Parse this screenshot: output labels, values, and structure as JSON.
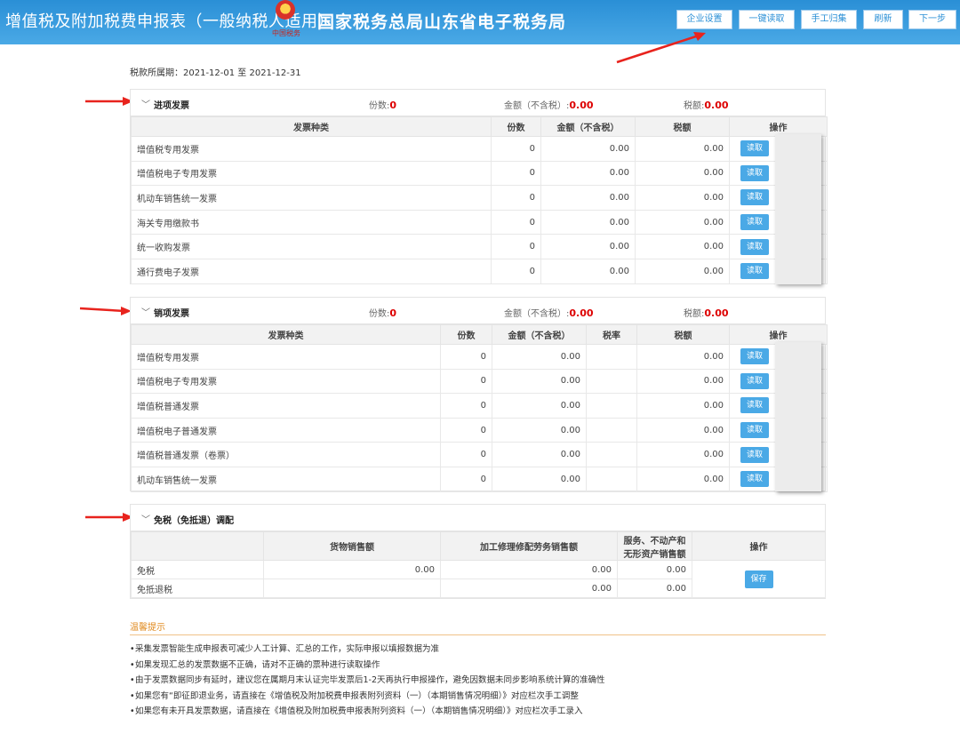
{
  "header": {
    "title": "增值税及附加税费申报表（一般纳税人适用）",
    "agency": "国家税务总局山东省电子税务局",
    "emblem_sub": "中国税务",
    "buttons": [
      "企业设置",
      "一键读取",
      "手工归集",
      "刷新",
      "下一步"
    ]
  },
  "period": "税款所属期：2021-12-01 至 2021-12-31",
  "input_invoices": {
    "section_title": "进项发票",
    "count_label": "份数:",
    "count": "0",
    "amount_label": "金额（不含税）:",
    "amount": "0.00",
    "tax_label": "税额:",
    "tax": "0.00",
    "columns": [
      "发票种类",
      "份数",
      "金额（不含税）",
      "税额",
      "操作"
    ],
    "rows": [
      {
        "type": "增值税专用发票",
        "count": "0",
        "amount": "0.00",
        "tax": "0.00",
        "action": "读取"
      },
      {
        "type": "增值税电子专用发票",
        "count": "0",
        "amount": "0.00",
        "tax": "0.00",
        "action": "读取"
      },
      {
        "type": "机动车销售统一发票",
        "count": "0",
        "amount": "0.00",
        "tax": "0.00",
        "action": "读取"
      },
      {
        "type": "海关专用缴款书",
        "count": "0",
        "amount": "0.00",
        "tax": "0.00",
        "action": "读取"
      },
      {
        "type": "统一收购发票",
        "count": "0",
        "amount": "0.00",
        "tax": "0.00",
        "action": "读取"
      },
      {
        "type": "通行费电子发票",
        "count": "0",
        "amount": "0.00",
        "tax": "0.00",
        "action": "读取"
      }
    ]
  },
  "output_invoices": {
    "section_title": "销项发票",
    "count_label": "份数:",
    "count": "0",
    "amount_label": "金额（不含税）:",
    "amount": "0.00",
    "tax_label": "税额:",
    "tax": "0.00",
    "columns": [
      "发票种类",
      "份数",
      "金额（不含税）",
      "税率",
      "税额",
      "操作"
    ],
    "rows": [
      {
        "type": "增值税专用发票",
        "count": "0",
        "amount": "0.00",
        "tax": "0.00",
        "action": "读取"
      },
      {
        "type": "增值税电子专用发票",
        "count": "0",
        "amount": "0.00",
        "tax": "0.00",
        "action": "读取"
      },
      {
        "type": "增值税普通发票",
        "count": "0",
        "amount": "0.00",
        "tax": "0.00",
        "action": "读取"
      },
      {
        "type": "增值税电子普通发票",
        "count": "0",
        "amount": "0.00",
        "tax": "0.00",
        "action": "读取"
      },
      {
        "type": "增值税普通发票（卷票）",
        "count": "0",
        "amount": "0.00",
        "tax": "0.00",
        "action": "读取"
      },
      {
        "type": "机动车销售统一发票",
        "count": "0",
        "amount": "0.00",
        "tax": "0.00",
        "action": "读取"
      }
    ]
  },
  "exempt": {
    "section_title": "免税（免抵退）调配",
    "columns": [
      "",
      "货物销售额",
      "加工修理修配劳务销售额",
      "服务、不动产和",
      "无形资产销售额",
      "操作"
    ],
    "rows": [
      {
        "label": "免税",
        "goods": "0.00",
        "labor": "0.00",
        "service": "0.00"
      },
      {
        "label": "免抵退税",
        "goods": "",
        "labor": "0.00",
        "service": "0.00"
      }
    ],
    "save_label": "保存"
  },
  "tips": {
    "title": "温馨提示",
    "items": [
      "采集发票智能生成申报表可减少人工计算、汇总的工作，实际申报以填报数据为准",
      "如果发现汇总的发票数据不正确，请对不正确的票种进行读取操作",
      "由于发票数据同步有延时，建议您在属期月末认证完毕发票后1-2天再执行申报操作，避免因数据未同步影响系统计算的准确性",
      "如果您有“即征即退业务，请直接在《增值税及附加税费申报表附列资料（一）（本期销售情况明细）》对应栏次手工调整",
      "如果您有未开具发票数据，请直接在《增值税及附加税费申报表附列资料（一）（本期销售情况明细）》对应栏次手工录入"
    ]
  },
  "colors": {
    "header": "#2a8fd6",
    "accent_red": "#dd0000",
    "button": "#4aa9e6",
    "tips": "#e08a1e"
  }
}
